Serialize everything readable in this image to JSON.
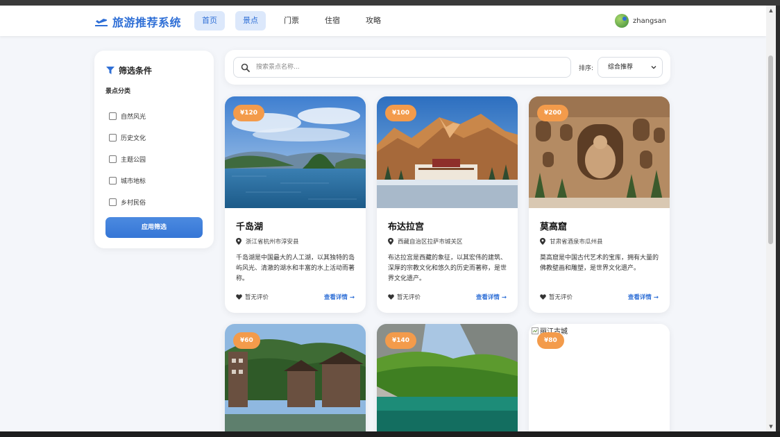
{
  "navbar": {
    "brand": "旅游推荐系统",
    "items": [
      {
        "label": "首页",
        "active": true
      },
      {
        "label": "景点",
        "active": true
      },
      {
        "label": "门票",
        "active": false
      },
      {
        "label": "住宿",
        "active": false
      },
      {
        "label": "攻略",
        "active": false
      }
    ],
    "username": "zhangsan"
  },
  "sidebar": {
    "title": "筛选条件",
    "category_heading": "景点分类",
    "categories": [
      "自然风光",
      "历史文化",
      "主题公园",
      "城市地标",
      "乡村民俗"
    ],
    "apply_label": "应用筛选"
  },
  "search": {
    "placeholder": "搜索景点名称...",
    "sort_label": "排序:",
    "sort_selected": "综合推荐"
  },
  "cards": [
    {
      "price": "¥120",
      "title": "千岛湖",
      "location": "浙江省杭州市淳安县",
      "description": "千岛湖是中国最大的人工湖，以其独特的岛屿风光、清澈的湖水和丰富的水上活动而著称。",
      "rating": "暂无评价",
      "link": "查看详情 →"
    },
    {
      "price": "¥100",
      "title": "布达拉宫",
      "location": "西藏自治区拉萨市城关区",
      "description": "布达拉宫是西藏的象征，以其宏伟的建筑、深厚的宗教文化和悠久的历史而著称，是世界文化遗产。",
      "rating": "暂无评价",
      "link": "查看详情 →"
    },
    {
      "price": "¥200",
      "title": "莫高窟",
      "location": "甘肃省酒泉市瓜州县",
      "description": "莫高窟是中国古代艺术的宝库，拥有大量的佛教壁画和雕塑，是世界文化遗产。",
      "rating": "暂无评价",
      "link": "查看详情 →"
    },
    {
      "price": "¥60"
    },
    {
      "price": "¥140"
    },
    {
      "price": "¥80",
      "image_alt": "丽江古城"
    }
  ],
  "colors": {
    "accent": "#2f6fd6",
    "badge": "#f39b4b",
    "background": "#f4f6fa"
  }
}
